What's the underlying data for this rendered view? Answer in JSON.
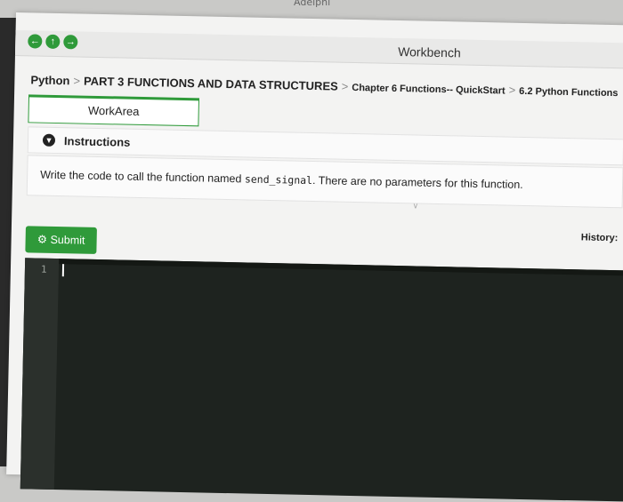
{
  "top_caption": "Adelphi",
  "window": {
    "title": "Workbench"
  },
  "nav": {
    "back_icon": "back-arrow-icon",
    "up_icon": "up-arrow-icon",
    "forward_icon": "forward-arrow-icon"
  },
  "breadcrumb": {
    "items": [
      "Python",
      "PART 3 FUNCTIONS AND DATA STRUCTURES",
      "Chapter 6 Functions-- QuickStart",
      "6.2 Python Functions"
    ]
  },
  "tabs": {
    "workarea": "WorkArea"
  },
  "instructions": {
    "title": "Instructions",
    "text_before": "Write the code to call the function named ",
    "code": "send_signal",
    "text_after": ". There are no parameters for this function."
  },
  "actions": {
    "submit": "Submit",
    "history": "History:"
  },
  "editor": {
    "line_number": "1"
  },
  "colors": {
    "accent": "#2f9a3a",
    "editor_bg": "#1e231f"
  }
}
